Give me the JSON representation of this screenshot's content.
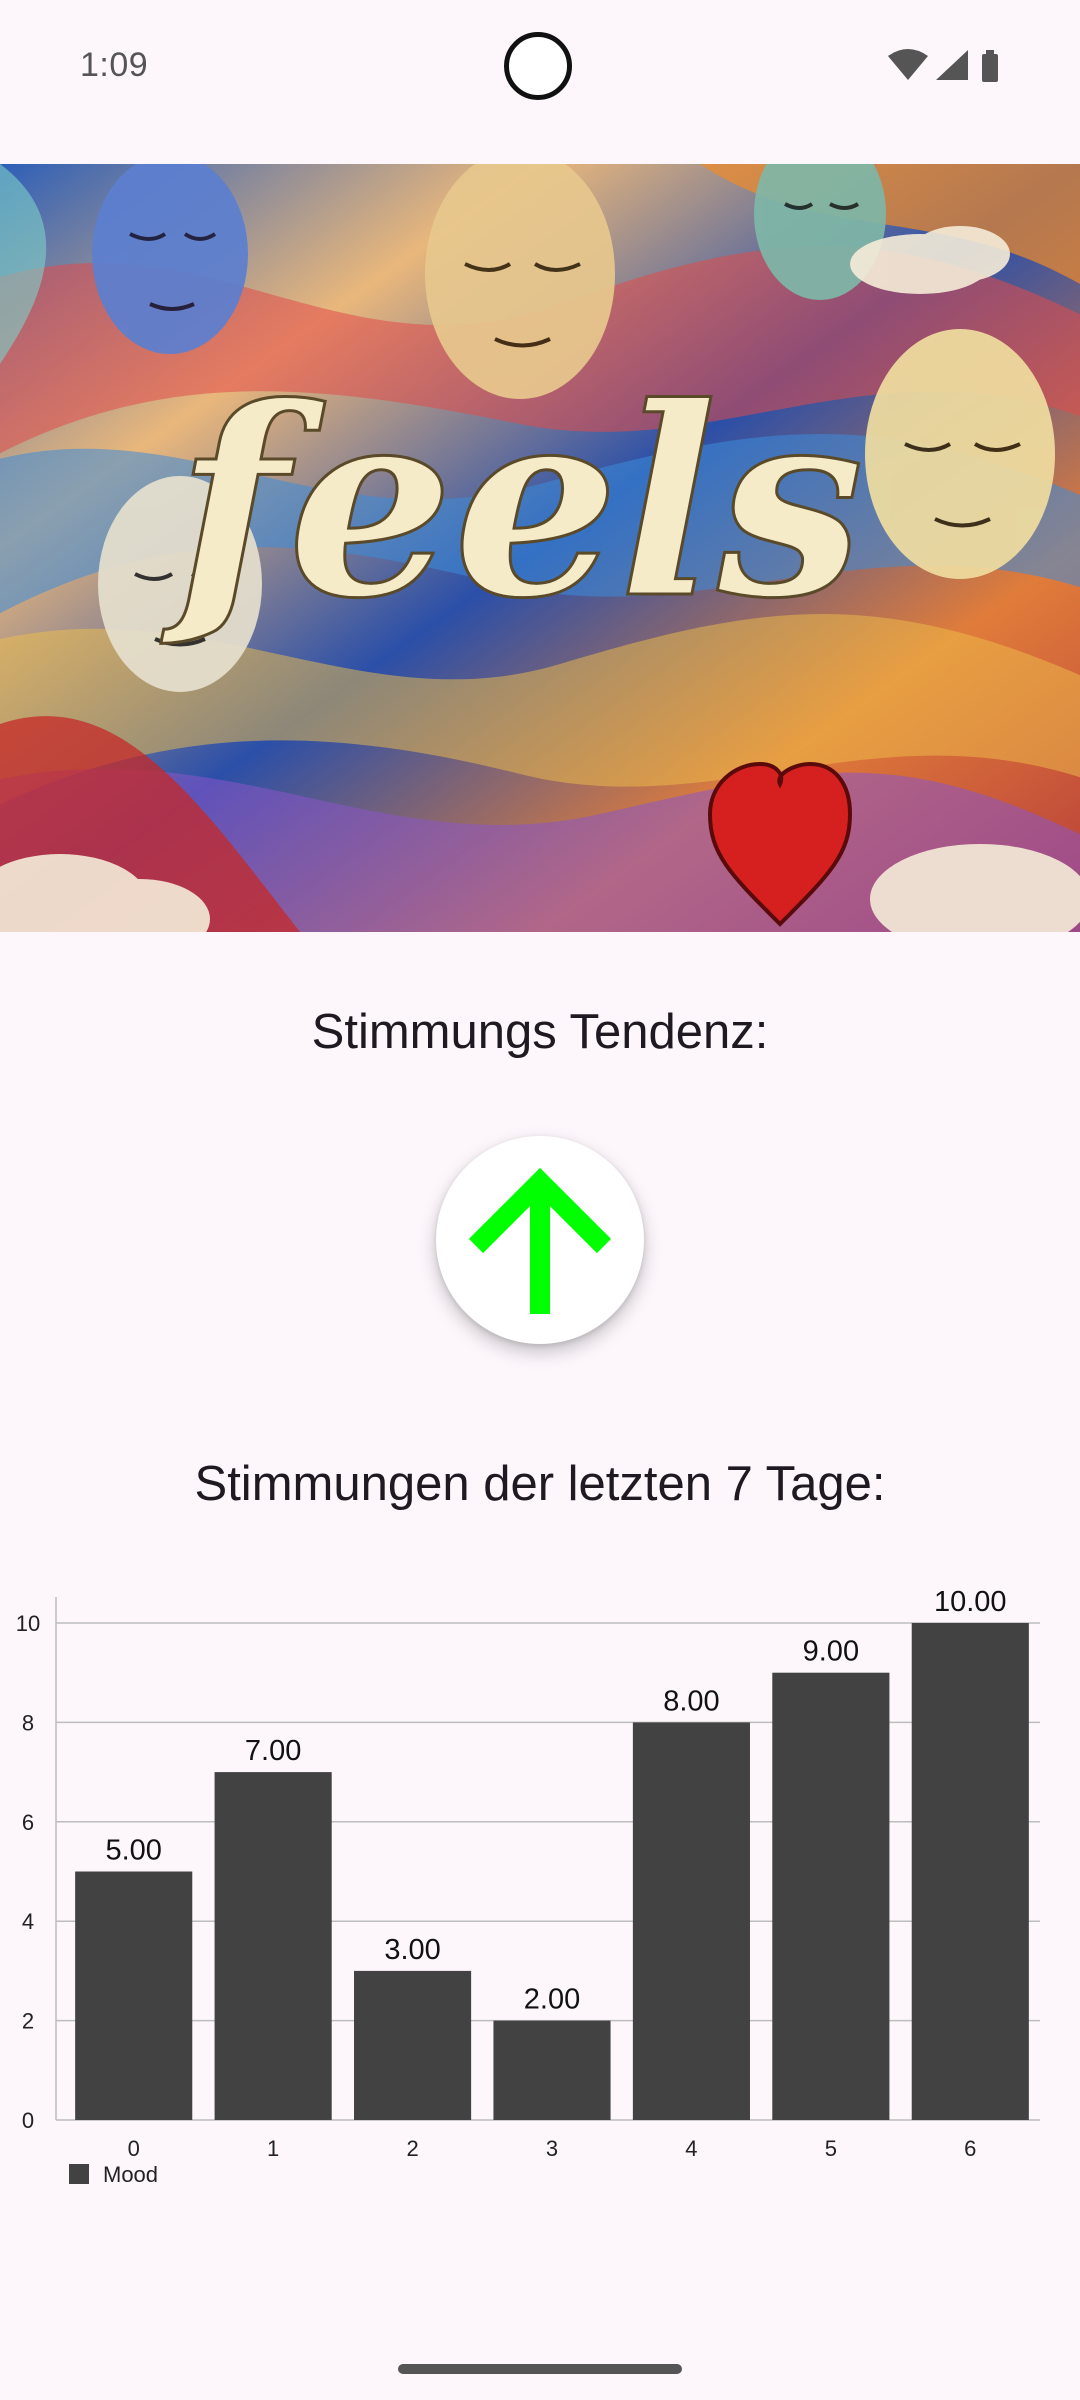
{
  "status_bar": {
    "time": "1:09",
    "icons": [
      "wifi-icon",
      "cell-signal-icon",
      "battery-icon"
    ]
  },
  "banner": {
    "logo_text": "feels",
    "icon": "heart-icon"
  },
  "trend": {
    "title": "Stimmungs Tendenz:",
    "icon": "arrow-up-icon",
    "icon_color": "#00FF00"
  },
  "chart_section": {
    "title": "Stimmungen der letzten 7 Tage:"
  },
  "chart_data": {
    "type": "bar",
    "categories": [
      "0",
      "1",
      "2",
      "3",
      "4",
      "5",
      "6"
    ],
    "series": [
      {
        "name": "Mood",
        "values": [
          5,
          7,
          3,
          2,
          8,
          9,
          10
        ],
        "color": "#424242"
      }
    ],
    "value_labels": [
      "5.00",
      "7.00",
      "3.00",
      "2.00",
      "8.00",
      "9.00",
      "10.00"
    ],
    "yticks": [
      "0",
      "2",
      "4",
      "6",
      "8",
      "10"
    ],
    "ylim": [
      0,
      10
    ],
    "grid": true,
    "legend_position": "bottom-left"
  },
  "colors": {
    "background": "#FDF7FC",
    "bar": "#424242",
    "trend_arrow": "#00FF00"
  }
}
